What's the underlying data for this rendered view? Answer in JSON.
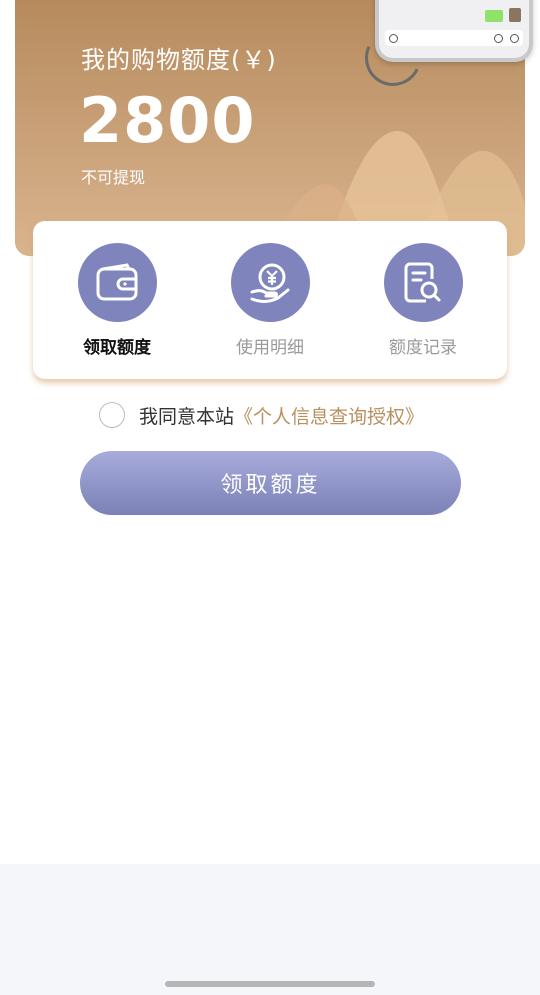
{
  "banner": {
    "title": "我的购物额度(￥)",
    "amount": "2800",
    "subtitle": "不可提现"
  },
  "actions": [
    {
      "label": "领取额度",
      "icon": "wallet-icon",
      "active": true
    },
    {
      "label": "使用明细",
      "icon": "yuan-hand-icon",
      "active": false
    },
    {
      "label": "额度记录",
      "icon": "document-search-icon",
      "active": false
    }
  ],
  "agreement": {
    "prefix": "我同意本站",
    "link": "《个人信息查询授权》",
    "checked": false
  },
  "cta_button": {
    "label": "领取额度"
  },
  "colors": {
    "accent": "#7f84bd",
    "banner": "#c49c72",
    "link": "#b8905f"
  }
}
